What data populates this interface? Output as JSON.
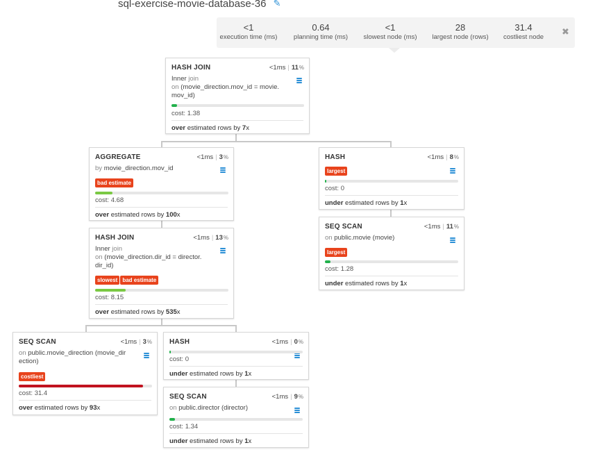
{
  "title": "sql-exercise-movie-database-36",
  "stats": [
    {
      "value": "<1",
      "label": "execution time (ms)"
    },
    {
      "value": "0.64",
      "label": "planning time (ms)"
    },
    {
      "value": "<1",
      "label": "slowest node (ms)"
    },
    {
      "value": "28",
      "label": "largest node (rows)"
    },
    {
      "value": "31.4",
      "label": "costliest node"
    }
  ],
  "close_glyph": "✖",
  "edit_glyph": "✎",
  "nodes": {
    "hash_join_top": {
      "name": "HASH JOIN",
      "time": "<1ms",
      "pct": "11",
      "pct_unit": "%",
      "join_type": "Inner",
      "join_word": "join",
      "cond_prefix": "on",
      "cond_line1": "(movie_direction.mov_id = movie.",
      "cond_line2": "mov_id)",
      "cost_label": "cost:",
      "cost": "1.38",
      "cost_fraction": 0.04,
      "est_dir": "over",
      "est_text": "estimated rows by",
      "est_factor": "7",
      "est_x": "x"
    },
    "aggregate": {
      "name": "AGGREGATE",
      "time": "<1ms",
      "pct": "3",
      "pct_unit": "%",
      "by_prefix": "by",
      "by_text": "movie_direction.mov_id",
      "tags": [
        "bad estimate"
      ],
      "cost_label": "cost:",
      "cost": "4.68",
      "cost_fraction": 0.13,
      "est_dir": "over",
      "est_text": "estimated rows by",
      "est_factor": "100",
      "est_x": "x"
    },
    "hash_join_mid": {
      "name": "HASH JOIN",
      "time": "<1ms",
      "pct": "13",
      "pct_unit": "%",
      "join_type": "Inner",
      "join_word": "join",
      "cond_prefix": "on",
      "cond_line1": "(movie_direction.dir_id = director.",
      "cond_line2": "dir_id)",
      "tags": [
        "slowest",
        "bad estimate"
      ],
      "cost_label": "cost:",
      "cost": "8.15",
      "cost_fraction": 0.23,
      "est_dir": "over",
      "est_text": "estimated rows by",
      "est_factor": "535",
      "est_x": "x"
    },
    "seq_scan_md": {
      "name": "SEQ SCAN",
      "time": "<1ms",
      "pct": "3",
      "pct_unit": "%",
      "on_prefix": "on",
      "on_line1": "public.movie_direction (movie_dir",
      "on_line2": "ection)",
      "tags": [
        "costliest"
      ],
      "cost_label": "cost:",
      "cost": "31.4",
      "cost_fraction": 0.93,
      "est_dir": "over",
      "est_text": "estimated rows by",
      "est_factor": "93",
      "est_x": "x"
    },
    "hash_left": {
      "name": "HASH",
      "time": "<1ms",
      "pct": "0",
      "pct_unit": "%",
      "cost_label": "cost:",
      "cost": "0",
      "cost_fraction": 0.005,
      "est_dir": "under",
      "est_text": "estimated rows by",
      "est_factor": "1",
      "est_x": "x"
    },
    "seq_scan_director": {
      "name": "SEQ SCAN",
      "time": "<1ms",
      "pct": "9",
      "pct_unit": "%",
      "on_prefix": "on",
      "on_text": "public.director (director)",
      "cost_label": "cost:",
      "cost": "1.34",
      "cost_fraction": 0.04,
      "est_dir": "under",
      "est_text": "estimated rows by",
      "est_factor": "1",
      "est_x": "x"
    },
    "hash_right": {
      "name": "HASH",
      "time": "<1ms",
      "pct": "8",
      "pct_unit": "%",
      "tags": [
        "largest"
      ],
      "cost_label": "cost:",
      "cost": "0",
      "cost_fraction": 0.005,
      "est_dir": "under",
      "est_text": "estimated rows by",
      "est_factor": "1",
      "est_x": "x"
    },
    "seq_scan_movie": {
      "name": "SEQ SCAN",
      "time": "<1ms",
      "pct": "11",
      "pct_unit": "%",
      "on_prefix": "on",
      "on_text": "public.movie (movie)",
      "tags": [
        "largest"
      ],
      "cost_label": "cost:",
      "cost": "1.28",
      "cost_fraction": 0.04,
      "est_dir": "under",
      "est_text": "estimated rows by",
      "est_factor": "1",
      "est_x": "x"
    }
  },
  "colors": {
    "cost_low": "#22b14c",
    "cost_mid": "#7ac943",
    "cost_high": "#c1121f",
    "tag": "#e8431c",
    "db_icon": "#2a8fd6"
  }
}
